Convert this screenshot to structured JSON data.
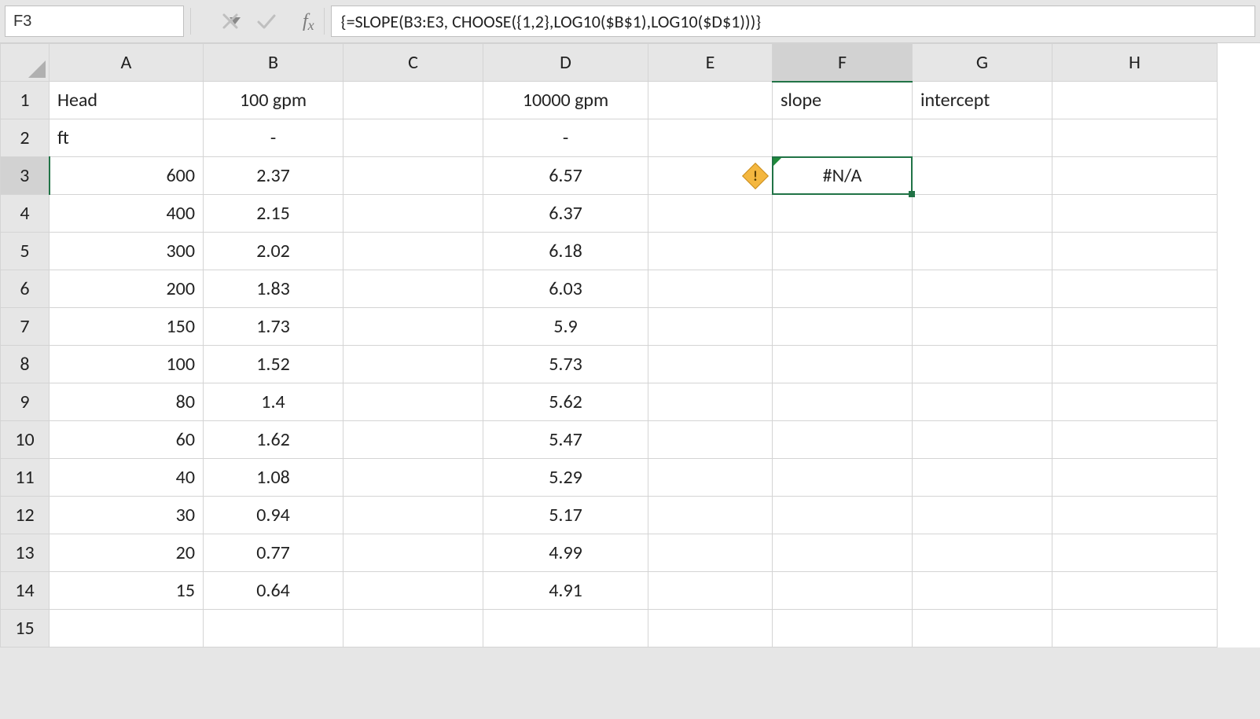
{
  "name_box": "F3",
  "formula": "{=SLOPE(B3:E3, CHOOSE({1,2},LOG10($B$1),LOG10($D$1)))}",
  "columns": [
    "A",
    "B",
    "C",
    "D",
    "E",
    "F",
    "G",
    "H"
  ],
  "active_col": "F",
  "active_row": 3,
  "rows": [
    {
      "n": 1,
      "A": "Head",
      "B": "100 gpm",
      "D": "10000 gpm",
      "F": "slope",
      "G": "intercept"
    },
    {
      "n": 2,
      "A": "ft",
      "B": "-",
      "D": "-"
    },
    {
      "n": 3,
      "A": "600",
      "B": "2.37",
      "D": "6.57",
      "F": "#N/A"
    },
    {
      "n": 4,
      "A": "400",
      "B": "2.15",
      "D": "6.37"
    },
    {
      "n": 5,
      "A": "300",
      "B": "2.02",
      "D": "6.18"
    },
    {
      "n": 6,
      "A": "200",
      "B": "1.83",
      "D": "6.03"
    },
    {
      "n": 7,
      "A": "150",
      "B": "1.73",
      "D": "5.9"
    },
    {
      "n": 8,
      "A": "100",
      "B": "1.52",
      "D": "5.73"
    },
    {
      "n": 9,
      "A": "80",
      "B": "1.4",
      "D": "5.62"
    },
    {
      "n": 10,
      "A": "60",
      "B": "1.62",
      "D": "5.47"
    },
    {
      "n": 11,
      "A": "40",
      "B": "1.08",
      "D": "5.29"
    },
    {
      "n": 12,
      "A": "30",
      "B": "0.94",
      "D": "5.17"
    },
    {
      "n": 13,
      "A": "20",
      "B": "0.77",
      "D": "4.99"
    },
    {
      "n": 14,
      "A": "15",
      "B": "0.64",
      "D": "4.91"
    },
    {
      "n": 15
    }
  ],
  "smart_tag_glyph": "!"
}
